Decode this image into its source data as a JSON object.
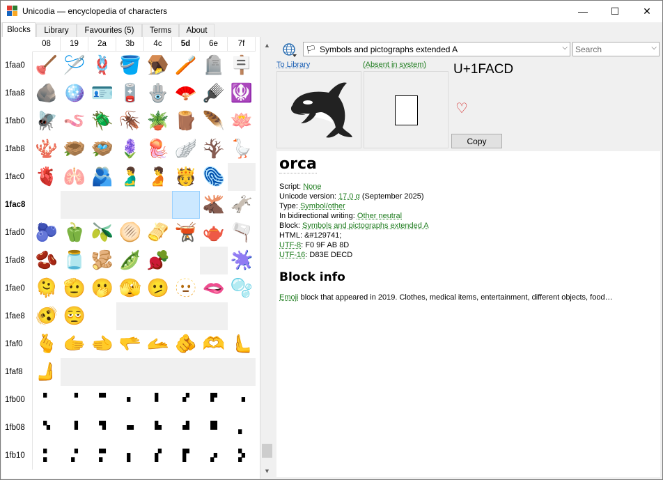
{
  "window": {
    "title": "Unicodia — encyclopedia of characters",
    "minimize": "—",
    "maximize": "☐",
    "close": "✕"
  },
  "tabs": [
    {
      "label": "Blocks",
      "active": true
    },
    {
      "label": "Library"
    },
    {
      "label": "Favourites (5)"
    },
    {
      "label": "Terms"
    },
    {
      "label": "About"
    }
  ],
  "grid": {
    "columns": [
      "08",
      "19",
      "2a",
      "3b",
      "4c",
      "5d",
      "6e",
      "7f"
    ],
    "bold_column": "5d",
    "rows": [
      {
        "label": "1faa0",
        "cells": [
          "🪠",
          "🪡",
          "🪢",
          "🪣",
          "🪤",
          "🪥",
          "🪦",
          "🪧"
        ]
      },
      {
        "label": "1faa8",
        "cells": [
          "🪨",
          "🪩",
          "🪪",
          "🪫",
          "🪬",
          "🪭",
          "🪮",
          "🪯"
        ]
      },
      {
        "label": "1fab0",
        "cells": [
          "🪰",
          "🪱",
          "🪲",
          "🪳",
          "🪴",
          "🪵",
          "🪶",
          "🪷"
        ]
      },
      {
        "label": "1fab8",
        "cells": [
          "🪸",
          "🪹",
          "🪺",
          "🪻",
          "🪼",
          "🪽",
          "🪾",
          "🪿"
        ]
      },
      {
        "label": "1fac0",
        "cells": [
          "🫀",
          "🫁",
          "🫂",
          "🫃",
          "🫄",
          "🫅",
          "🫆",
          ""
        ]
      },
      {
        "label": "1fac8",
        "bold": true,
        "cells": [
          "🫈",
          "",
          "",
          "",
          "",
          "🫍",
          "🫎",
          "🫏"
        ]
      },
      {
        "label": "1fad0",
        "cells": [
          "🫐",
          "🫑",
          "🫒",
          "🫓",
          "🫔",
          "🫕",
          "🫖",
          "🫗"
        ]
      },
      {
        "label": "1fad8",
        "cells": [
          "🫘",
          "🫙",
          "🫚",
          "🫛",
          "🫜",
          "🫝",
          "",
          "🫟"
        ]
      },
      {
        "label": "1fae0",
        "cells": [
          "🫠",
          "🫡",
          "🫢",
          "🫣",
          "🫤",
          "🫥",
          "🫦",
          "🫧"
        ]
      },
      {
        "label": "1fae8",
        "cells": [
          "🫨",
          "🫩",
          "🫪",
          "",
          "",
          "",
          "",
          "🫯"
        ]
      },
      {
        "label": "1faf0",
        "cells": [
          "🫰",
          "🫱",
          "🫲",
          "🫳",
          "🫴",
          "🫵",
          "🫶",
          "🫷"
        ]
      },
      {
        "label": "1faf8",
        "cells": [
          "🫸",
          "",
          "",
          "",
          "",
          "",
          "",
          ""
        ]
      },
      {
        "label": "1fb00",
        "cells": [
          "🬀",
          "🬁",
          "🬂",
          "🬃",
          "🬄",
          "🬅",
          "🬆",
          "🬇"
        ]
      },
      {
        "label": "1fb08",
        "cells": [
          "🬈",
          "🬉",
          "🬊",
          "🬋",
          "🬌",
          "🬍",
          "🬎",
          "🬏"
        ]
      },
      {
        "label": "1fb10",
        "cells": [
          "🬐",
          "🬑",
          "🬒",
          "🬓",
          "🬔",
          "🬕",
          "🬖",
          "🬗"
        ]
      }
    ]
  },
  "toolbar": {
    "block_selector": "Symbols and pictographs extended A",
    "search_placeholder": "Search"
  },
  "preview": {
    "to_library": "To Library",
    "absent": "(Absent in system)",
    "codepoint": "U+1FACD",
    "copy": "Copy"
  },
  "info": {
    "name": "orca",
    "props": [
      {
        "label": "Script: ",
        "value": "None",
        "link": true
      },
      {
        "label": "Unicode version: ",
        "value": "17.0 α",
        "link": true,
        "suffix": " (September 2025)"
      },
      {
        "label": "Type: ",
        "value": "Symbol/other",
        "link": true
      },
      {
        "label": "In bidirectional writing: ",
        "value": "Other neutral",
        "link": true
      },
      {
        "label": "Block: ",
        "value": "Symbols and pictographs extended A",
        "link": true
      },
      {
        "label": "HTML: ",
        "value": "&#129741;",
        "link": false
      },
      {
        "label": "",
        "value": "UTF-8",
        "link": true,
        "suffix": ": F0 9F AB 8D"
      },
      {
        "label": "",
        "value": "UTF-16",
        "link": true,
        "suffix": ": D83E DECD"
      }
    ],
    "block_info_title": "Block info",
    "block_info_link": "Emoji",
    "block_info_text": " block that appeared in 2019. Clothes, medical items, entertainment, different objects, food…"
  }
}
